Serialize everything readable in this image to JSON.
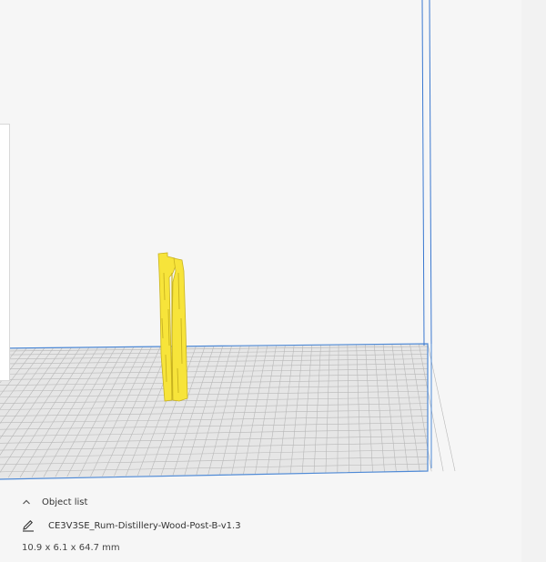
{
  "object_list": {
    "header_label": "Object list",
    "toggle_icon": "chevron-up-icon"
  },
  "object": {
    "name": "CE3V3SE_Rum-Distillery-Wood-Post-B-v1.3",
    "edit_icon": "pencil-icon",
    "dimensions": "10.9 x 6.1 x 64.7 mm"
  },
  "colors": {
    "viewport_bg": "#f6f6f6",
    "build_plate": "#e6e6e6",
    "grid_line": "#b8b8b8",
    "plate_border": "#4f8ad6",
    "volume_edge": "#3a78d0",
    "model_fill": "#f7e43a",
    "model_shadow": "#c9b320"
  }
}
